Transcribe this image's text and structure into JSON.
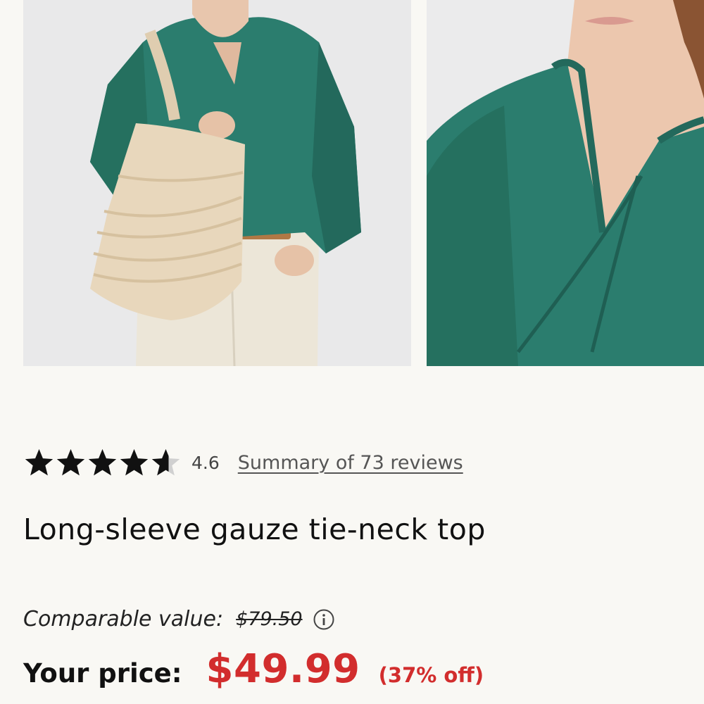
{
  "gallery": {
    "images": [
      {
        "alt": "Model wearing green long-sleeve gauze top with straw tote bag"
      },
      {
        "alt": "Close-up of green gauze tie-neck top"
      }
    ]
  },
  "product": {
    "rating": {
      "value": "4.6",
      "stars_filled": 4.6,
      "stars_total": 5,
      "reviews_link": "Summary of 73 reviews"
    },
    "title": "Long-sleeve gauze tie-neck top",
    "pricing": {
      "comparable_label": "Comparable value:",
      "comparable_price": "$79.50",
      "your_price_label": "Your price:",
      "price": "$49.99",
      "discount": "(37% off)"
    }
  },
  "colors": {
    "sale_red": "#d22d2d",
    "background": "#f9f8f4",
    "blouse_green": "#2b7d6e"
  }
}
